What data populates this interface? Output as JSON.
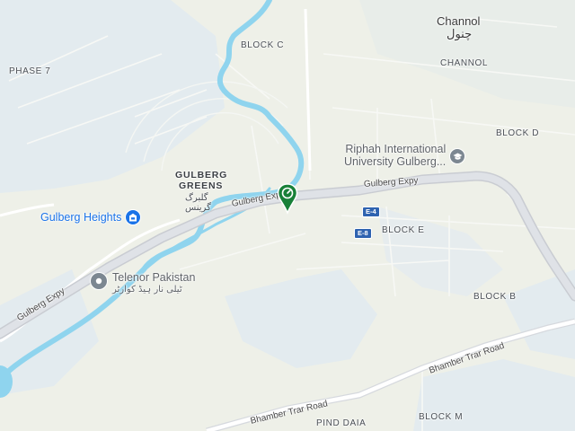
{
  "labels": {
    "channol_title": "Channol",
    "channol_urdu": "چنول",
    "channol_caps": "CHANNOL",
    "block_c": "BLOCK C",
    "phase_7": "PHASE 7",
    "block_d": "BLOCK D",
    "block_e": "BLOCK E",
    "block_b": "BLOCK B",
    "block_m": "BLOCK M",
    "pind_daia": "PIND DAIA",
    "gulberg_greens_1": "GULBERG",
    "gulberg_greens_2": "GREENS",
    "gulberg_urdu_1": "گلبرگ",
    "gulberg_urdu_2": "گرینس"
  },
  "pois": {
    "riphah_line1": "Riphah International",
    "riphah_line2": "University Gulberg...",
    "gulberg_heights": "Gulberg Heights",
    "telenor": "Telenor Pakistan",
    "telenor_urdu": "ٹیلی نار ہیڈ کوارٹر"
  },
  "roads": {
    "gulberg_expy_1": "Gulberg Expy",
    "gulberg_expy_2": "Gulberg Exp",
    "gulberg_expy_3": "Gulberg Expy",
    "bhamber_1": "Bhamber Trar Road",
    "bhamber_2": "Bhamber Trar Road"
  },
  "shields": {
    "e4": "E-4",
    "e8": "E-8"
  },
  "colors": {
    "land": "#eef0e8",
    "urban": "#e3ebef",
    "river": "#8fd4ee",
    "highway": "#d8dbe0",
    "poi_blue": "#1a73e8",
    "poi_gray": "#7c8791",
    "marker_green": "#188038"
  },
  "icons": {
    "university": "graduation-cap-icon",
    "building": "building-icon",
    "place": "place-pin-icon",
    "marker": "gas-station-pin-icon"
  }
}
